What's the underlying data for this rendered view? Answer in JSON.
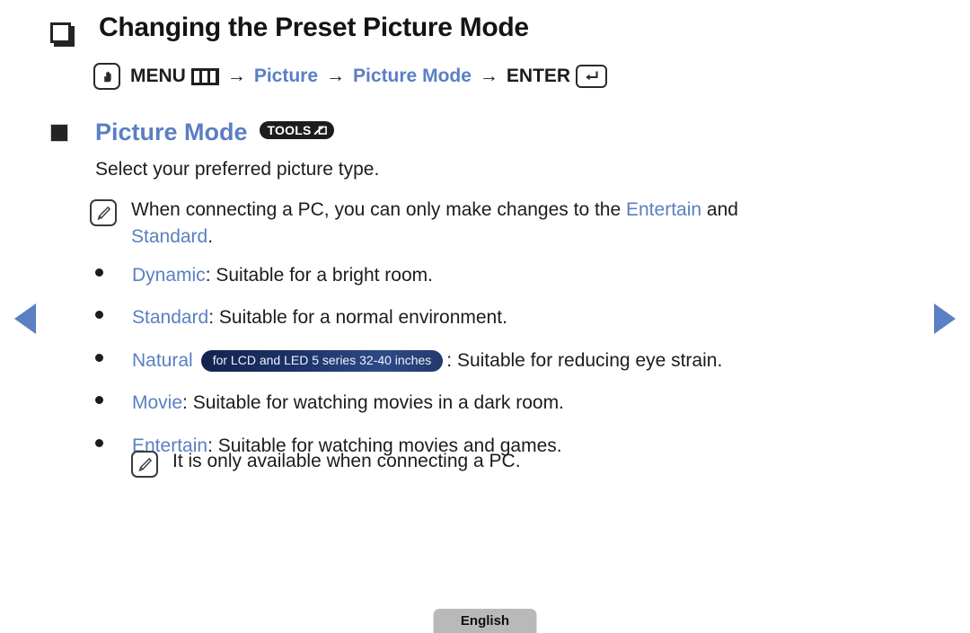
{
  "page": {
    "heading": "Changing the Preset Picture Mode",
    "menu_path": {
      "remote_icon": "hand-press-icon",
      "menu_label": "MENU",
      "menu_icon": "menu-grid-icon",
      "arrow": "→",
      "step1": "Picture",
      "step2": "Picture Mode",
      "enter_label": "ENTER",
      "enter_icon": "enter-return-icon"
    },
    "section": {
      "marker": "filled-square-marker",
      "title": "Picture Mode",
      "tools_badge": "TOOLS",
      "tools_badge_icon": "tools-arrow-icon"
    },
    "description": "Select your preferred picture type.",
    "note_top": {
      "icon": "note-pencil-icon",
      "text_before": "When connecting a PC, you can only make changes to the ",
      "highlight_1": "Entertain",
      "text_middle": " and",
      "highlight_2": "Standard",
      "text_after": "."
    },
    "bullets": [
      {
        "name": "Dynamic",
        "badge": null,
        "rest": ": Suitable for a bright room."
      },
      {
        "name": "Standard",
        "badge": null,
        "rest": ": Suitable for a normal environment."
      },
      {
        "name": "Natural",
        "badge": "for LCD and LED 5 series 32-40 inches",
        "rest": ": Suitable for reducing eye strain."
      },
      {
        "name": "Movie",
        "badge": null,
        "rest": ": Suitable for watching movies in a dark room."
      },
      {
        "name": "Entertain",
        "badge": null,
        "rest": ": Suitable for watching movies and games."
      }
    ],
    "note_bottom": {
      "icon": "note-pencil-icon",
      "text": "It is only available when connecting a PC."
    },
    "nav": {
      "prev_icon": "triangle-left-icon",
      "next_icon": "triangle-right-icon"
    },
    "footer": {
      "language_label": "English"
    },
    "colors": {
      "accent_blue": "#5a7fc3",
      "text_dark": "#1c1c1c",
      "badge_navy": "#1b3266",
      "tools_dark": "#1c1c1c",
      "footer_gray": "#b9b9b9"
    }
  }
}
